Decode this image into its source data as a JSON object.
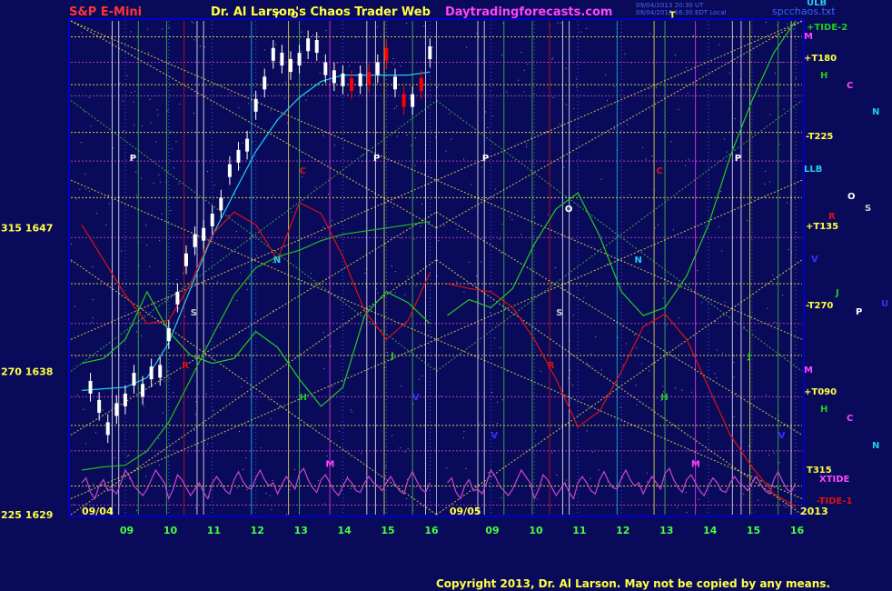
{
  "header": {
    "left": "S&P E-Mini",
    "center": "Dr. Al Larson's Chaos Trader Web",
    "site": "Daytradingforecasts.com",
    "stamp1": "09/04/2013 20:30 UT",
    "stamp2": "09/04/2013 16:30 EDT Local",
    "stamp3": "",
    "file": "spcchaos.txt"
  },
  "footer": {
    "copyright": "Copyright 2013, Dr. Al Larson. May not be copied by any means."
  },
  "colors": {
    "background": "#0a0a5a",
    "plot_border": "#0000cc",
    "price_bars": "#ffffff",
    "recent_bars": "#ff0000",
    "moving_avg": "#22ccee",
    "tide_line": "#22bb22",
    "red_line": "#dd1111",
    "green_curve": "#22cc22",
    "xtide_wave": "#cc44cc",
    "grid_yellow": "#ffee44",
    "grid_green": "#44cc44"
  },
  "chart_data": {
    "type": "line",
    "title": "S&P E-Mini",
    "instrument": "S&P E-Mini",
    "y_axis": [
      {
        "label": "315  1647",
        "angle": 315,
        "price": 1647
      },
      {
        "label": "270  1638",
        "angle": 270,
        "price": 1638
      },
      {
        "label": "225  1629",
        "angle": 225,
        "price": 1629
      }
    ],
    "ylim": [
      1629,
      1660
    ],
    "date_labels": [
      "09/04",
      "09/05",
      "2013"
    ],
    "hour_ticks_day1": [
      "09",
      "10",
      "11",
      "12",
      "13",
      "14",
      "15",
      "16"
    ],
    "hour_ticks_day2": [
      "09",
      "10",
      "11",
      "12",
      "13",
      "14",
      "15",
      "16"
    ],
    "right_labels": [
      {
        "label": "ULB",
        "color": "#22ccee"
      },
      {
        "label": "+TIDE-2",
        "color": "#22cc22"
      },
      {
        "label": "M",
        "color": "#ff44ff"
      },
      {
        "label": "+T180",
        "color": "#ffff44"
      },
      {
        "label": "H",
        "color": "#22cc22"
      },
      {
        "label": "C",
        "color": "#ff44ff"
      },
      {
        "label": "N",
        "color": "#22ccee"
      },
      {
        "label": "-T225",
        "color": "#ffff44"
      },
      {
        "label": "LLB",
        "color": "#22ccee"
      },
      {
        "label": "O",
        "color": "#ffffff"
      },
      {
        "label": "S",
        "color": "#cccccc"
      },
      {
        "label": "R",
        "color": "#dd1111"
      },
      {
        "label": "+T135",
        "color": "#ffff44"
      },
      {
        "label": "V",
        "color": "#3333ff"
      },
      {
        "label": "J",
        "color": "#22cc22"
      },
      {
        "label": "-T270",
        "color": "#ffff44"
      },
      {
        "label": "U",
        "color": "#3333ff"
      },
      {
        "label": "P",
        "color": "#ffffff"
      },
      {
        "label": "M",
        "color": "#ff44ff"
      },
      {
        "label": "+T090",
        "color": "#ffff44"
      },
      {
        "label": "H",
        "color": "#22cc22"
      },
      {
        "label": "C",
        "color": "#ff44ff"
      },
      {
        "label": "N",
        "color": "#22ccee"
      },
      {
        "label": "T315",
        "color": "#ffff44"
      },
      {
        "label": "XTIDE",
        "color": "#ff44ff"
      },
      {
        "label": "-TIDE-1",
        "color": "#dd1111"
      }
    ],
    "planet_markers": [
      {
        "t": "P",
        "day": 0,
        "h": 9.1,
        "p": 1651.2,
        "color": "#ffffff"
      },
      {
        "t": "S",
        "day": 0,
        "h": 10.5,
        "p": 1641.5,
        "color": "#cccccc"
      },
      {
        "t": "R",
        "day": 0,
        "h": 10.3,
        "p": 1638.2,
        "color": "#dd1111"
      },
      {
        "t": "N",
        "day": 0,
        "h": 12.4,
        "p": 1644.8,
        "color": "#22ccee"
      },
      {
        "t": "O",
        "day": 0,
        "h": 12.8,
        "p": 1660.2,
        "color": "#ffff44"
      },
      {
        "t": "T",
        "day": 0,
        "h": 12.4,
        "p": 1660.2,
        "color": "#ffff44"
      },
      {
        "t": "C",
        "day": 0,
        "h": 13.0,
        "p": 1650.4,
        "color": "#dd1111"
      },
      {
        "t": "H",
        "day": 0,
        "h": 13.0,
        "p": 1636.2,
        "color": "#22cc22"
      },
      {
        "t": "M",
        "day": 0,
        "h": 13.6,
        "p": 1632.0,
        "color": "#ff44ff"
      },
      {
        "t": "P",
        "day": 0,
        "h": 14.7,
        "p": 1651.2,
        "color": "#ffffff"
      },
      {
        "t": "J",
        "day": 0,
        "h": 15.1,
        "p": 1638.8,
        "color": "#22cc22"
      },
      {
        "t": "V",
        "day": 0,
        "h": 15.6,
        "p": 1636.2,
        "color": "#3333ff"
      },
      {
        "t": "P",
        "day": 1,
        "h": 8.8,
        "p": 1651.2,
        "color": "#ffffff"
      },
      {
        "t": "V",
        "day": 1,
        "h": 9.0,
        "p": 1633.8,
        "color": "#3333ff"
      },
      {
        "t": "S",
        "day": 1,
        "h": 10.5,
        "p": 1641.5,
        "color": "#cccccc"
      },
      {
        "t": "O",
        "day": 1,
        "h": 10.7,
        "p": 1648.0,
        "color": "#ffffff"
      },
      {
        "t": "R",
        "day": 1,
        "h": 10.3,
        "p": 1638.2,
        "color": "#dd1111"
      },
      {
        "t": "N",
        "day": 1,
        "h": 12.3,
        "p": 1644.8,
        "color": "#22ccee"
      },
      {
        "t": "T",
        "day": 1,
        "h": 13.1,
        "p": 1660.2,
        "color": "#ffff44"
      },
      {
        "t": "C",
        "day": 1,
        "h": 12.8,
        "p": 1650.4,
        "color": "#dd1111"
      },
      {
        "t": "H",
        "day": 1,
        "h": 12.9,
        "p": 1636.2,
        "color": "#22cc22"
      },
      {
        "t": "M",
        "day": 1,
        "h": 13.6,
        "p": 1632.0,
        "color": "#ff44ff"
      },
      {
        "t": "P",
        "day": 1,
        "h": 14.6,
        "p": 1651.2,
        "color": "#ffffff"
      },
      {
        "t": "J",
        "day": 1,
        "h": 14.9,
        "p": 1638.8,
        "color": "#22cc22"
      },
      {
        "t": "V",
        "day": 1,
        "h": 15.6,
        "p": 1633.8,
        "color": "#3333ff"
      }
    ],
    "price_series": {
      "name": "S&P E-Mini",
      "x": [
        8.2,
        8.4,
        8.6,
        8.8,
        9.0,
        9.2,
        9.4,
        9.6,
        9.8,
        10.0,
        10.2,
        10.4,
        10.6,
        10.8,
        11.0,
        11.2,
        11.4,
        11.6,
        11.8,
        12.0,
        12.2,
        12.4,
        12.6,
        12.8,
        13.0,
        13.2,
        13.4,
        13.6,
        13.8,
        14.0,
        14.2,
        14.4,
        14.6,
        14.8,
        15.0,
        15.2,
        15.4,
        15.6,
        15.8,
        16.0
      ],
      "y": [
        1637.0,
        1635.8,
        1634.4,
        1635.6,
        1636.2,
        1637.5,
        1636.8,
        1637.9,
        1638.0,
        1640.3,
        1642.6,
        1645.0,
        1646.2,
        1646.6,
        1647.5,
        1648.5,
        1650.6,
        1651.5,
        1652.2,
        1654.7,
        1656.1,
        1657.9,
        1657.6,
        1657.2,
        1657.6,
        1658.5,
        1658.4,
        1657.0,
        1656.5,
        1656.3,
        1656.0,
        1656.3,
        1656.4,
        1657.0,
        1657.9,
        1656.1,
        1655.0,
        1655.0,
        1656.0,
        1658.0
      ]
    },
    "red_curve": {
      "name": "",
      "day1_x": [
        8.0,
        8.5,
        9.0,
        9.5,
        10.0,
        10.5,
        11.0,
        11.5,
        12.0,
        12.5,
        13.0,
        13.5,
        14.0,
        14.5,
        15.0,
        15.5,
        16.0
      ],
      "day1_y": [
        1647.2,
        1645.0,
        1642.8,
        1641.0,
        1641.2,
        1643.5,
        1646.6,
        1648.0,
        1647.2,
        1645.0,
        1648.6,
        1647.9,
        1645.2,
        1641.8,
        1640.0,
        1641.2,
        1644.2
      ],
      "day2_x": [
        8.0,
        8.5,
        9.0,
        9.5,
        10.0,
        10.5,
        11.0,
        11.5,
        12.0,
        12.5,
        13.0,
        13.5,
        14.0,
        14.5,
        15.0,
        15.5,
        16.0
      ],
      "day2_y": [
        1643.5,
        1643.2,
        1643.0,
        1642.0,
        1640.0,
        1637.5,
        1634.5,
        1635.5,
        1638.0,
        1640.8,
        1641.6,
        1640.0,
        1637.0,
        1634.0,
        1632.0,
        1630.3,
        1629.5
      ]
    },
    "green_curve": {
      "name": "",
      "day1_x": [
        8.0,
        8.5,
        9.0,
        9.5,
        10.0,
        10.5,
        11.0,
        11.5,
        12.0,
        12.5,
        13.0,
        13.5,
        14.0,
        14.5,
        15.0,
        15.5,
        16.0
      ],
      "day1_y": [
        1638.5,
        1638.8,
        1640.0,
        1643.0,
        1640.5,
        1639.0,
        1638.5,
        1638.8,
        1640.5,
        1639.5,
        1637.5,
        1635.8,
        1637.0,
        1641.5,
        1643.0,
        1642.3,
        1641.0
      ],
      "day2_x": [
        8.0,
        8.5,
        9.0,
        9.5,
        10.0,
        10.5,
        11.0,
        11.5,
        12.0,
        12.5,
        13.0,
        13.5,
        14.0,
        14.5,
        15.0,
        15.5,
        16.0
      ],
      "day2_y": [
        1641.5,
        1642.5,
        1642.0,
        1643.2,
        1646.0,
        1648.2,
        1649.2,
        1646.5,
        1643.0,
        1641.5,
        1642.0,
        1644.0,
        1647.2,
        1651.5,
        1655.0,
        1658.0,
        1660.0
      ]
    },
    "ma_series": {
      "name": "",
      "day1_x": [
        8.0,
        8.5,
        9.0,
        9.5,
        10.0,
        10.5,
        11.0,
        11.5,
        12.0,
        12.5,
        13.0,
        13.5,
        14.0,
        14.5,
        15.0,
        15.5,
        16.0
      ],
      "day1_y": [
        1636.8,
        1636.9,
        1637.0,
        1637.6,
        1639.8,
        1643.2,
        1646.5,
        1649.2,
        1651.8,
        1653.8,
        1655.2,
        1656.2,
        1656.6,
        1656.6,
        1656.6,
        1656.6,
        1656.8
      ]
    },
    "tide_series": {
      "name": "",
      "day1_x": [
        8.0,
        8.5,
        9.0,
        9.5,
        10.0,
        10.5,
        11.0,
        11.5,
        12.0,
        12.5,
        13.0,
        13.5,
        14.0,
        14.5,
        15.0,
        15.5,
        16.0
      ],
      "day1_y": [
        1631.8,
        1632.0,
        1632.1,
        1633.0,
        1634.8,
        1637.5,
        1640.2,
        1642.8,
        1644.5,
        1645.2,
        1645.6,
        1646.2,
        1646.6,
        1646.8,
        1647.0,
        1647.2,
        1647.4
      ]
    },
    "xtide_series": {
      "name": "XTIDE",
      "x": [
        8.0,
        8.1,
        8.2,
        8.3,
        8.4,
        8.5,
        8.6,
        8.7,
        8.8,
        8.9,
        9.0,
        9.1,
        9.2,
        9.3,
        9.4,
        9.5,
        9.6,
        9.7,
        9.8,
        9.9,
        10.0,
        10.1,
        10.2,
        10.3,
        10.4,
        10.5,
        10.6,
        10.7,
        10.8,
        10.9,
        11.0,
        11.1,
        11.2,
        11.3,
        11.4,
        11.5,
        11.6,
        11.7,
        11.8,
        11.9,
        12.0,
        12.1,
        12.2,
        12.3,
        12.4,
        12.5,
        12.6,
        12.7,
        12.8,
        12.9,
        13.0,
        13.1,
        13.2,
        13.3,
        13.4,
        13.5,
        13.6,
        13.7,
        13.8,
        13.9,
        14.0,
        14.1,
        14.2,
        14.3,
        14.4,
        14.5,
        14.6,
        14.7,
        14.8,
        14.9,
        15.0,
        15.1,
        15.2,
        15.3,
        15.4,
        15.5,
        15.6,
        15.7,
        15.8,
        15.9,
        16.0
      ],
      "y": [
        1631.0,
        1631.3,
        1630.4,
        1630.0,
        1630.8,
        1631.2,
        1630.5,
        1630.6,
        1630.3,
        1631.0,
        1631.8,
        1631.4,
        1630.8,
        1630.5,
        1630.2,
        1630.6,
        1631.2,
        1631.8,
        1631.4,
        1631.0,
        1630.0,
        1630.6,
        1631.5,
        1631.2,
        1630.7,
        1630.2,
        1630.6,
        1631.0,
        1630.4,
        1630.0,
        1631.0,
        1631.4,
        1631.0,
        1630.5,
        1630.3,
        1631.2,
        1631.7,
        1631.1,
        1630.7,
        1630.6,
        1631.3,
        1631.8,
        1631.2,
        1630.8,
        1631.0,
        1630.3,
        1630.9,
        1631.4,
        1631.0,
        1630.6,
        1631.6,
        1631.9,
        1631.2,
        1630.7,
        1630.4,
        1631.2,
        1631.5,
        1631.0,
        1630.5,
        1630.2,
        1630.8,
        1631.3,
        1631.0,
        1630.5,
        1630.4,
        1631.0,
        1631.4,
        1631.0,
        1630.8,
        1630.5,
        1631.0,
        1631.4,
        1630.9,
        1630.5,
        1630.3,
        1631.2,
        1631.7,
        1631.1,
        1630.6,
        1630.4,
        1631.0
      ]
    }
  }
}
